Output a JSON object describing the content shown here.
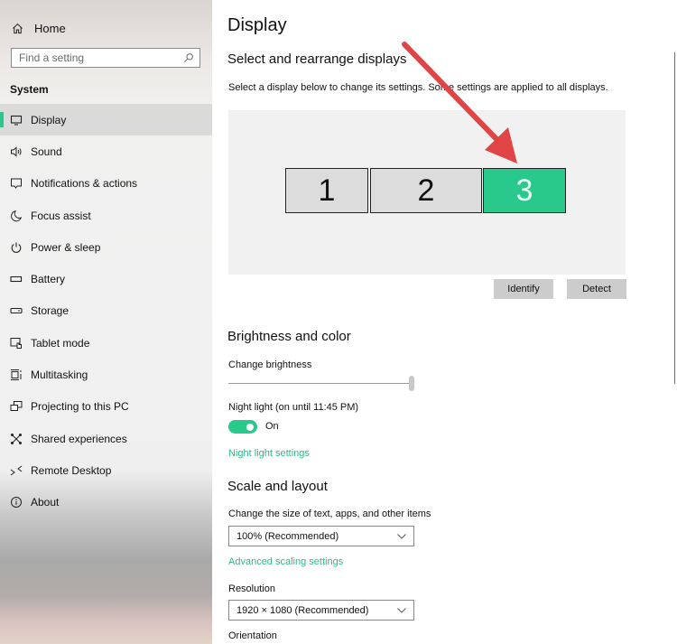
{
  "sidebar": {
    "home_label": "Home",
    "search_placeholder": "Find a setting",
    "section_label": "System",
    "items": [
      {
        "label": "Display",
        "icon": "monitor-icon",
        "active": true
      },
      {
        "label": "Sound",
        "icon": "speaker-icon"
      },
      {
        "label": "Notifications & actions",
        "icon": "notification-icon"
      },
      {
        "label": "Focus assist",
        "icon": "moon-icon"
      },
      {
        "label": "Power & sleep",
        "icon": "power-icon"
      },
      {
        "label": "Battery",
        "icon": "battery-icon"
      },
      {
        "label": "Storage",
        "icon": "storage-icon"
      },
      {
        "label": "Tablet mode",
        "icon": "tablet-mode-icon"
      },
      {
        "label": "Multitasking",
        "icon": "multitasking-icon"
      },
      {
        "label": "Projecting to this PC",
        "icon": "projecting-icon"
      },
      {
        "label": "Shared experiences",
        "icon": "shared-experiences-icon"
      },
      {
        "label": "Remote Desktop",
        "icon": "remote-desktop-icon"
      },
      {
        "label": "About",
        "icon": "info-icon"
      }
    ]
  },
  "main": {
    "title": "Display",
    "arrange": {
      "heading": "Select and rearrange displays",
      "description": "Select a display below to change its settings. Some settings are applied to all displays.",
      "monitors": [
        {
          "number": "1",
          "selected": false
        },
        {
          "number": "2",
          "selected": false
        },
        {
          "number": "3",
          "selected": true
        }
      ],
      "identify_label": "Identify",
      "detect_label": "Detect"
    },
    "brightness": {
      "heading": "Brightness and color",
      "brightness_label": "Change brightness",
      "brightness_value_percent": 100,
      "night_light_label": "Night light (on until 11:45 PM)",
      "night_light_state": "On",
      "night_light_settings_link": "Night light settings"
    },
    "scale": {
      "heading": "Scale and layout",
      "size_label": "Change the size of text, apps, and other items",
      "size_value": "100% (Recommended)",
      "advanced_link": "Advanced scaling settings",
      "resolution_label": "Resolution",
      "resolution_value": "1920 × 1080 (Recommended)",
      "orientation_label": "Orientation"
    }
  },
  "colors": {
    "accent": "#28c98b",
    "link": "#2eb884",
    "annotation_arrow": "#e04444"
  }
}
